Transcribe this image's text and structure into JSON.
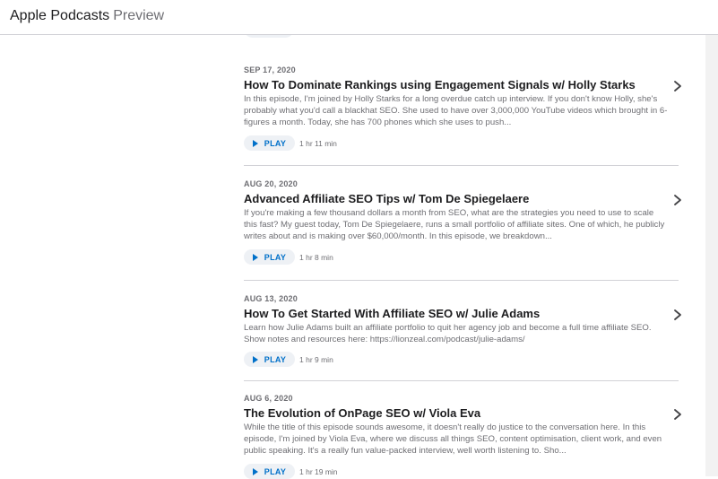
{
  "header": {
    "brand": "Apple Podcasts",
    "suffix": "Preview"
  },
  "episodes": [
    {
      "date": "SEP 17, 2020",
      "title": "How To Dominate Rankings using Engagement Signals w/ Holly Starks",
      "description": "In this episode, I'm joined by Holly Starks for a long overdue catch up interview. If you don't know Holly, she's probably what you'd call a blackhat SEO. She used to have over 3,000,000 YouTube videos which brought in 6-figures a month. Today, she has 700 phones which she uses to push...",
      "play_label": "PLAY",
      "duration": "1 hr 11 min"
    },
    {
      "date": "AUG 20, 2020",
      "title": "Advanced Affiliate SEO Tips w/ Tom De Spiegelaere",
      "description": "If you're making a few thousand dollars a month from SEO, what are the strategies you need to use to scale this fast? My guest today, Tom De Spiegelaere, runs a small portfolio of affiliate sites. One of which, he publicly writes about and is making over $60,000/month. In this episode, we breakdown...",
      "play_label": "PLAY",
      "duration": "1 hr 8 min"
    },
    {
      "date": "AUG 13, 2020",
      "title": "How To Get Started With Affiliate SEO w/ Julie Adams",
      "description": "Learn how Julie Adams built an affiliate portfolio to quit her agency job and become a full time affiliate SEO. Show notes and resources here: https://lionzeal.com/podcast/julie-adams/",
      "play_label": "PLAY",
      "duration": "1 hr 9 min"
    },
    {
      "date": "AUG 6, 2020",
      "title": "The Evolution of OnPage SEO w/ Viola Eva",
      "description": "While the title of this episode sounds awesome, it doesn't really do justice to the conversation here. In this episode, I'm joined by Viola Eva, where we discuss all things SEO, content optimisation, client work, and even public speaking. It's a really fun value-packed interview, well worth listening to. Sho...",
      "play_label": "PLAY",
      "duration": "1 hr 19 min"
    }
  ],
  "icons": {
    "play": "play-icon",
    "chevron": "chevron-right-icon"
  },
  "colors": {
    "accent": "#0070c9",
    "text": "#1d1d1f",
    "secondary": "#6e6e73",
    "divider": "#d2d2d7",
    "play_bg": "#eef1f5"
  }
}
